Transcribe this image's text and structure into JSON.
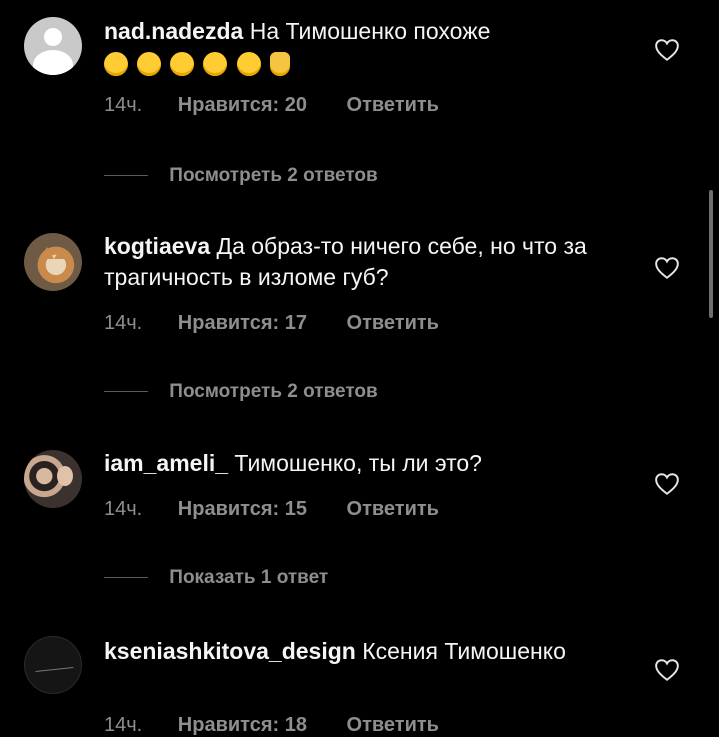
{
  "comments": [
    {
      "username": "nad.nadezda",
      "text": "На Тимошенко похоже",
      "time": "14ч.",
      "likes": "Нравится: 20",
      "reply": "Ответить",
      "view_replies": "Посмотреть 2 ответов",
      "avatar": "default-avatar-icon",
      "emojis": [
        "winking-face-icon",
        "hugging-face-icon",
        "tears-of-joy-icon",
        "tears-of-joy-icon",
        "tears-of-joy-icon",
        "thumbs-up-icon"
      ]
    },
    {
      "username": "kogtiaeva",
      "text": "Да образ-то ничего себе, но что за трагичность в изломе губ?",
      "time": "14ч.",
      "likes": "Нравится: 17",
      "reply": "Ответить",
      "view_replies": "Посмотреть 2 ответов",
      "avatar": "cat-photo"
    },
    {
      "username": "iam_ameli_",
      "text": "Тимошенко, ты ли это?",
      "time": "14ч.",
      "likes": "Нравится: 15",
      "reply": "Ответить",
      "view_replies": "Показать 1 ответ",
      "avatar": "two-people-photo"
    },
    {
      "username": "kseniashkitova_design",
      "text": "Ксения Тимошенко",
      "time": "14ч.",
      "likes": "Нравится: 18",
      "reply": "Ответить",
      "avatar": "signature-logo"
    }
  ],
  "colors": {
    "background": "#000000",
    "text": "#f5f5f5",
    "secondary": "#8e8e8e"
  }
}
